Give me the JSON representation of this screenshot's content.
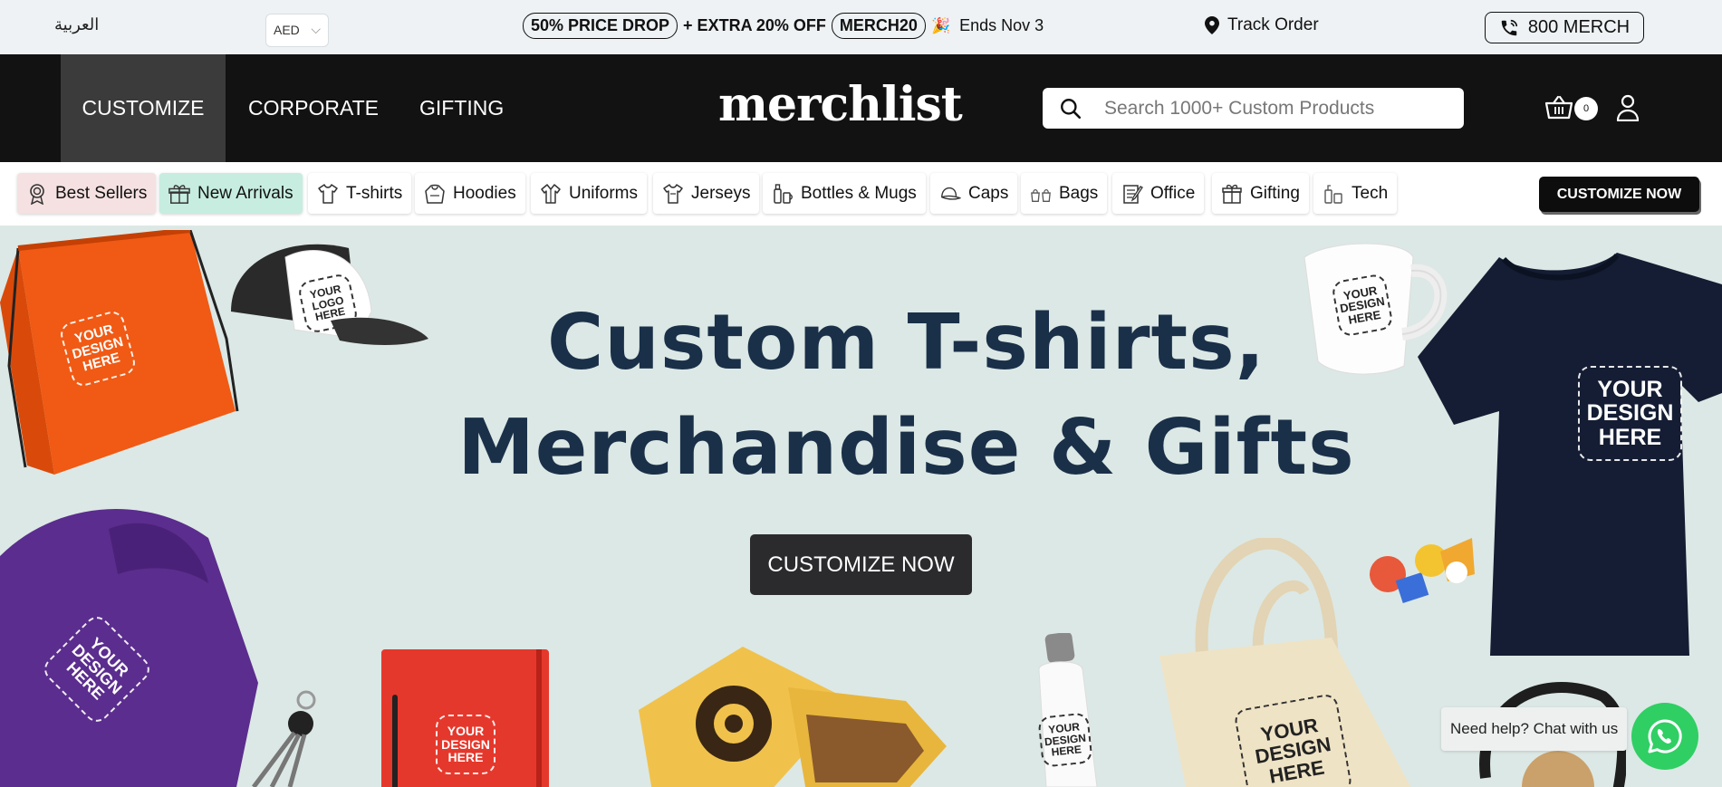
{
  "topbar": {
    "language": "العربية",
    "currency": "AED",
    "promo_drop": "50% PRICE DROP",
    "promo_extra": "+ EXTRA 20% OFF",
    "promo_code": "MERCH20",
    "promo_ends": "Ends Nov 3",
    "track_order": "Track Order",
    "phone": "800 MERCH"
  },
  "nav": {
    "tabs": [
      {
        "label": "CUSTOMIZE",
        "active": true
      },
      {
        "label": "CORPORATE",
        "active": false
      },
      {
        "label": "GIFTING",
        "active": false
      }
    ],
    "logo": "merchlist",
    "search_placeholder": "Search 1000+ Custom Products",
    "cart_count": "0"
  },
  "categories": [
    {
      "label": "Best Sellers",
      "icon": "award-icon"
    },
    {
      "label": "New Arrivals",
      "icon": "gift-box-icon"
    },
    {
      "label": "T-shirts",
      "icon": "tshirt-icon"
    },
    {
      "label": "Hoodies",
      "icon": "hoodie-icon"
    },
    {
      "label": "Uniforms",
      "icon": "uniform-icon"
    },
    {
      "label": "Jerseys",
      "icon": "jersey-icon"
    },
    {
      "label": "Bottles & Mugs",
      "icon": "bottle-icon"
    },
    {
      "label": "Caps",
      "icon": "cap-icon"
    },
    {
      "label": "Bags",
      "icon": "bag-icon"
    },
    {
      "label": "Office",
      "icon": "notebook-icon"
    },
    {
      "label": "Gifting",
      "icon": "gift-icon"
    },
    {
      "label": "Tech",
      "icon": "tech-icon"
    }
  ],
  "category_cta": "CUSTOMIZE NOW",
  "hero": {
    "headline_line1": "Custom T-shirts,",
    "headline_line2": "Merchandise & Gifts",
    "cta": "CUSTOMIZE NOW",
    "tag_design": "YOUR DESIGN HERE",
    "tag_logo": "YOUR LOGO HERE"
  },
  "chat": {
    "label": "Need help? Chat with us"
  },
  "colors": {
    "navy_text": "#1a3049",
    "nav_bg": "#121212",
    "hero_bg": "#dce8e5",
    "whatsapp": "#2fcf64"
  }
}
